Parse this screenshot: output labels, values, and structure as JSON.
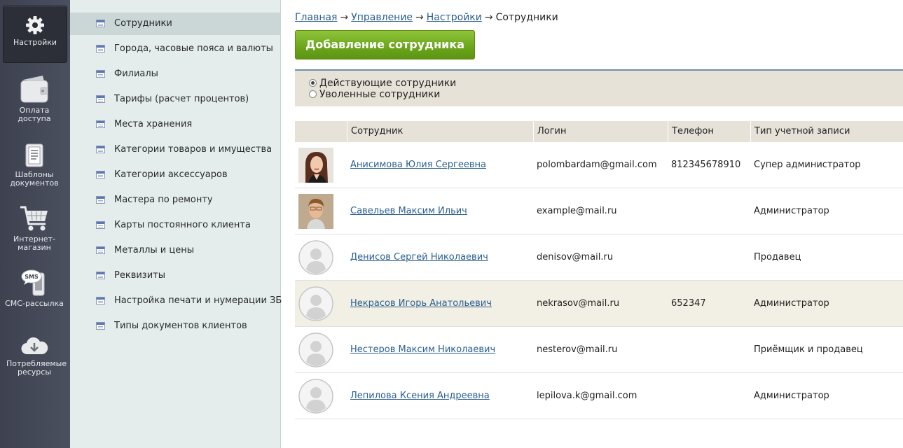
{
  "appbar": {
    "items": [
      {
        "label": "Настройки",
        "icon": "gear-icon",
        "active": true
      },
      {
        "label": "Оплата доступа",
        "icon": "wallet-icon"
      },
      {
        "label": "Шаблоны документов",
        "icon": "document-icon"
      },
      {
        "label": "Интернет-магазин",
        "icon": "cart-icon"
      },
      {
        "label": "СМС-рассылка",
        "icon": "sms-phone-icon",
        "icon_text": "SMS"
      },
      {
        "label": "Потребляемые ресурсы",
        "icon": "cloud-download-icon"
      }
    ]
  },
  "subnav": {
    "items": [
      {
        "label": "Сотрудники",
        "active": true
      },
      {
        "label": "Города, часовые пояса и валюты"
      },
      {
        "label": "Филиалы"
      },
      {
        "label": "Тарифы (расчет процентов)"
      },
      {
        "label": "Места хранения"
      },
      {
        "label": "Категории товаров и имущества"
      },
      {
        "label": "Категории аксессуаров"
      },
      {
        "label": "Мастера по ремонту"
      },
      {
        "label": "Карты постоянного клиента"
      },
      {
        "label": "Металлы и цены"
      },
      {
        "label": "Реквизиты"
      },
      {
        "label": "Настройка печати и нумерации ЗБ"
      },
      {
        "label": "Типы документов клиентов"
      }
    ]
  },
  "breadcrumb": {
    "items": [
      "Главная",
      "Управление",
      "Настройки"
    ],
    "separator": "→",
    "current": "Сотрудники"
  },
  "add_button": {
    "label": "Добавление сотрудника"
  },
  "filter": {
    "options": [
      {
        "label": "Действующие сотрудники",
        "checked": true
      },
      {
        "label": "Уволенные сотрудники",
        "checked": false
      }
    ]
  },
  "table": {
    "columns": [
      "Сотрудник",
      "Логин",
      "Телефон",
      "Тип учетной записи"
    ],
    "rows": [
      {
        "name": "Анисимова Юлия Сергеевна",
        "login": "polombardam@gmail.com",
        "phone": "812345678910",
        "type": "Супер администратор",
        "avatar": "photo-female"
      },
      {
        "name": "Савельев Максим Ильич",
        "login": "example@mail.ru",
        "phone": "",
        "type": "Администратор",
        "avatar": "photo-male"
      },
      {
        "name": "Денисов Сергей Николаевич",
        "login": "denisov@mail.ru",
        "phone": "",
        "type": "Продавец",
        "avatar": "placeholder"
      },
      {
        "name": "Некрасов Игорь Анатольевич",
        "login": "nekrasov@mail.ru",
        "phone": "652347",
        "type": "Администратор",
        "avatar": "placeholder",
        "highlighted": true
      },
      {
        "name": "Нестеров Максим Николаевич",
        "login": "nesterov@mail.ru",
        "phone": "",
        "type": "Приёмщик и продавец",
        "avatar": "placeholder"
      },
      {
        "name": "Лепилова Ксения Андреевна",
        "login": "lepilova.k@gmail.com",
        "phone": "",
        "type": "Администратор",
        "avatar": "placeholder"
      }
    ]
  },
  "colors": {
    "accent_green": "#6aa51b",
    "link": "#2a5f8f",
    "appbar_bg": "#474b59",
    "subnav_bg": "#e4ecec",
    "header_bg": "#e6e2d8"
  }
}
